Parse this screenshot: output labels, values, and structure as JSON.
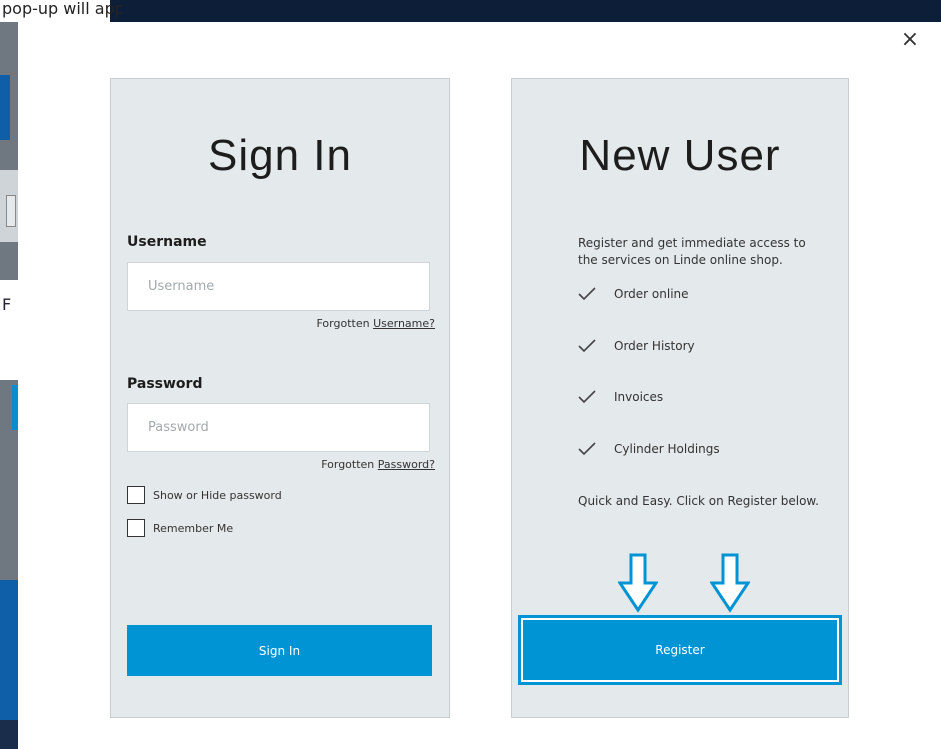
{
  "background": {
    "top_text": "pop-up will appear for Sign-in",
    "left_letter": "F"
  },
  "modal": {
    "close_glyph": "×"
  },
  "signin": {
    "title": "Sign In",
    "username_label": "Username",
    "username_placeholder": "Username",
    "forgot_username_prefix": "Forgotten",
    "forgot_username_link": "Username?",
    "password_label": "Password",
    "password_placeholder": "Password",
    "forgot_password_prefix": "Forgotten",
    "forgot_password_link": "Password?",
    "show_hide_label": "Show or Hide password",
    "remember_label": "Remember Me",
    "submit_label": "Sign In"
  },
  "newuser": {
    "title": "New User",
    "description": "Register and get immediate access to the services on Linde online shop.",
    "benefits": [
      "Order online",
      "Order History",
      "Invoices",
      "Cylinder Holdings"
    ],
    "quick_text": "Quick and Easy. Click on Register below.",
    "register_label": "Register"
  },
  "colors": {
    "accent": "#0094d4",
    "panel_bg": "#e4e9eb",
    "dark_bar": "#0d1f38"
  },
  "icons": {
    "close": "close-icon",
    "check": "checkmark-icon",
    "arrow": "arrow-down-icon"
  }
}
